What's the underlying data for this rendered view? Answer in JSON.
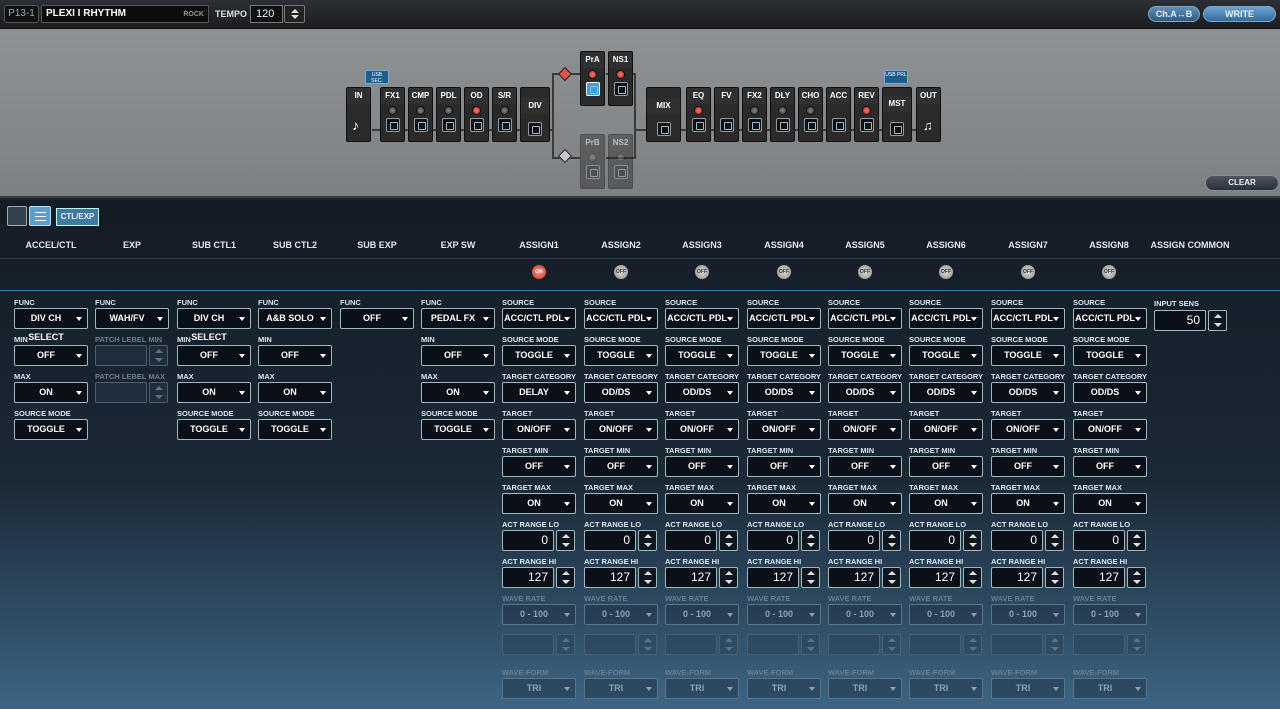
{
  "topbar": {
    "patch_number": "P13-1",
    "patch_name": "PLEXI I RHYTHM",
    "patch_category": "ROCK",
    "tempo_label": "TEMPO",
    "tempo_value": "120",
    "cha_b_label": "Ch.A↔B",
    "write_label": "WRITE"
  },
  "chain": {
    "blocks": {
      "in": "IN",
      "fx1": "FX1",
      "cmp": "CMP",
      "pdl": "PDL",
      "od": "OD",
      "sr": "S/R",
      "div": "DIV",
      "pra": "PrA",
      "ns1": "NS1",
      "prb": "PrB",
      "ns2": "NS2",
      "mix": "MIX",
      "eq": "EQ",
      "fv": "FV",
      "fx2": "FX2",
      "dly": "DLY",
      "cho": "CHO",
      "acc": "ACC",
      "rev": "REV",
      "mst": "MST",
      "out": "OUT"
    },
    "usb_sec": "USB SEC.",
    "usb_prl": "USB PRL",
    "clear_label": "CLEAR"
  },
  "panel": {
    "tab_label": "CTL/EXP",
    "headers": [
      "ACCEL/CTL",
      "EXP",
      "SUB CTL1",
      "SUB CTL2",
      "SUB EXP",
      "EXP SW",
      "ASSIGN1",
      "ASSIGN2",
      "ASSIGN3",
      "ASSIGN4",
      "ASSIGN5",
      "ASSIGN6",
      "ASSIGN7",
      "ASSIGN8",
      "ASSIGN COMMON"
    ],
    "assign_switches": [
      "ON",
      "OFF",
      "OFF",
      "OFF",
      "OFF",
      "OFF",
      "OFF",
      "OFF"
    ],
    "accel": {
      "func_label": "FUNC",
      "func": "DIV CH SELECT",
      "min_label": "MIN",
      "min": "OFF",
      "max_label": "MAX",
      "max": "ON",
      "srcmode_label": "SOURCE MODE",
      "srcmode": "TOGGLE"
    },
    "exp": {
      "func_label": "FUNC",
      "func": "WAH/FV",
      "min_label": "PATCH LEBEL MIN",
      "max_label": "PATCH LEBEL MAX"
    },
    "subctl1": {
      "func_label": "FUNC",
      "func": "DIV CH SELECT",
      "min_label": "MIN",
      "min": "OFF",
      "max_label": "MAX",
      "max": "ON",
      "srcmode_label": "SOURCE MODE",
      "srcmode": "TOGGLE"
    },
    "subctl2": {
      "func_label": "FUNC",
      "func": "A&B SOLO",
      "min_label": "MIN",
      "min": "OFF",
      "max_label": "MAX",
      "max": "ON",
      "srcmode_label": "SOURCE MODE",
      "srcmode": "TOGGLE"
    },
    "subexp": {
      "func_label": "FUNC",
      "func": "OFF"
    },
    "expsw": {
      "func_label": "FUNC",
      "func": "PEDAL FX",
      "min_label": "MIN",
      "min": "OFF",
      "max_label": "MAX",
      "max": "ON",
      "srcmode_label": "SOURCE MODE",
      "srcmode": "TOGGLE"
    },
    "assign_labels": {
      "source": "SOURCE",
      "source_mode": "SOURCE MODE",
      "target_category": "TARGET CATEGORY",
      "target": "TARGET",
      "target_min": "TARGET MIN",
      "target_max": "TARGET MAX",
      "act_lo": "ACT RANGE LO",
      "act_hi": "ACT RANGE HI",
      "wave_rate": "WAVE RATE",
      "wave_form": "WAVE-FORM"
    },
    "assigns": [
      {
        "source": "ACC/CTL PDL",
        "source_mode": "TOGGLE",
        "target_category": "DELAY",
        "target": "ON/OFF",
        "target_min": "OFF",
        "target_max": "ON",
        "act_lo": "0",
        "act_hi": "127",
        "wave_rate": "0 - 100",
        "wave_form": "TRI"
      },
      {
        "source": "ACC/CTL PDL",
        "source_mode": "TOGGLE",
        "target_category": "OD/DS",
        "target": "ON/OFF",
        "target_min": "OFF",
        "target_max": "ON",
        "act_lo": "0",
        "act_hi": "127",
        "wave_rate": "0 - 100",
        "wave_form": "TRI"
      },
      {
        "source": "ACC/CTL PDL",
        "source_mode": "TOGGLE",
        "target_category": "OD/DS",
        "target": "ON/OFF",
        "target_min": "OFF",
        "target_max": "ON",
        "act_lo": "0",
        "act_hi": "127",
        "wave_rate": "0 - 100",
        "wave_form": "TRI"
      },
      {
        "source": "ACC/CTL PDL",
        "source_mode": "TOGGLE",
        "target_category": "OD/DS",
        "target": "ON/OFF",
        "target_min": "OFF",
        "target_max": "ON",
        "act_lo": "0",
        "act_hi": "127",
        "wave_rate": "0 - 100",
        "wave_form": "TRI"
      },
      {
        "source": "ACC/CTL PDL",
        "source_mode": "TOGGLE",
        "target_category": "OD/DS",
        "target": "ON/OFF",
        "target_min": "OFF",
        "target_max": "ON",
        "act_lo": "0",
        "act_hi": "127",
        "wave_rate": "0 - 100",
        "wave_form": "TRI"
      },
      {
        "source": "ACC/CTL PDL",
        "source_mode": "TOGGLE",
        "target_category": "OD/DS",
        "target": "ON/OFF",
        "target_min": "OFF",
        "target_max": "ON",
        "act_lo": "0",
        "act_hi": "127",
        "wave_rate": "0 - 100",
        "wave_form": "TRI"
      },
      {
        "source": "ACC/CTL PDL",
        "source_mode": "TOGGLE",
        "target_category": "OD/DS",
        "target": "ON/OFF",
        "target_min": "OFF",
        "target_max": "ON",
        "act_lo": "0",
        "act_hi": "127",
        "wave_rate": "0 - 100",
        "wave_form": "TRI"
      },
      {
        "source": "ACC/CTL PDL",
        "source_mode": "TOGGLE",
        "target_category": "OD/DS",
        "target": "ON/OFF",
        "target_min": "OFF",
        "target_max": "ON",
        "act_lo": "0",
        "act_hi": "127",
        "wave_rate": "0 - 100",
        "wave_form": "TRI"
      }
    ],
    "common": {
      "input_sens_label": "INPUT SENS",
      "input_sens": "50"
    }
  }
}
